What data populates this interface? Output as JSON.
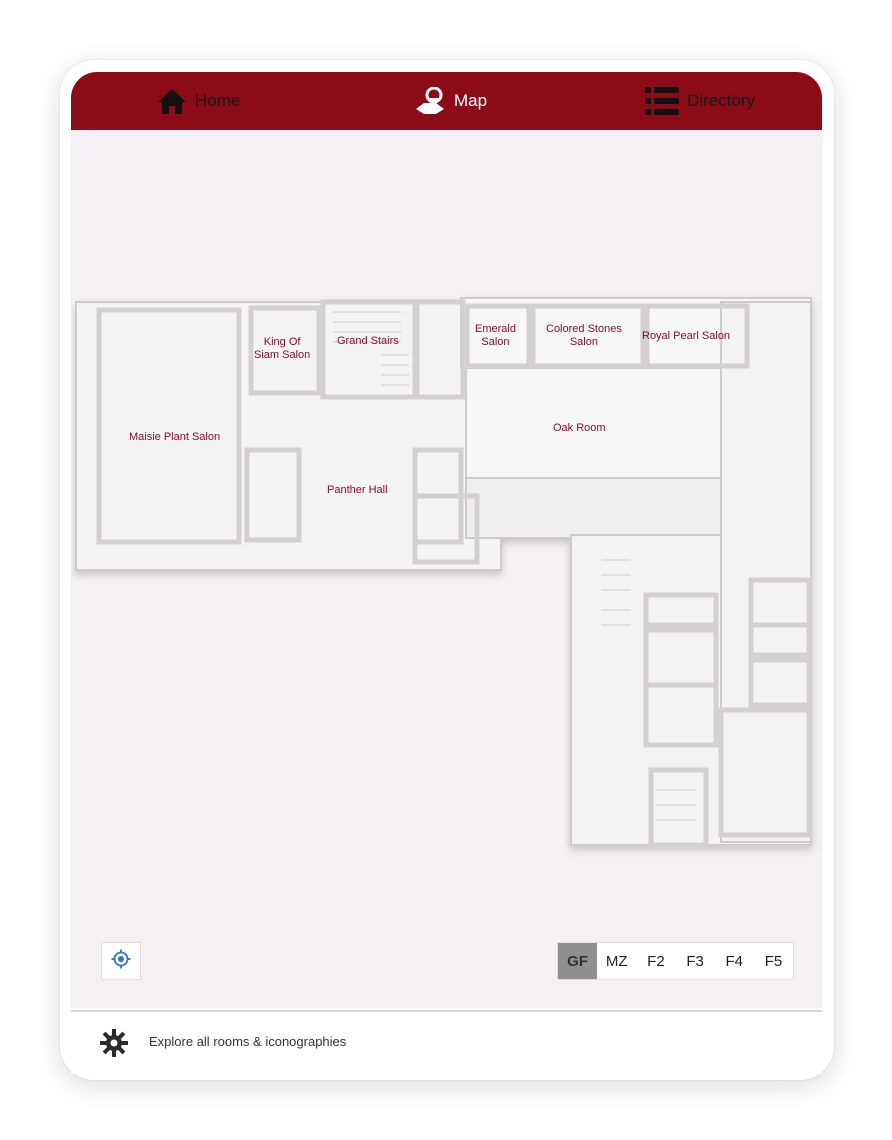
{
  "nav": {
    "home_label": "Home",
    "map_label": "Map",
    "directory_label": "Directory",
    "home_icon": "home-icon",
    "map_icon": "map-pin-icon",
    "directory_icon": "list-icon",
    "bar_color": "#8b0c16"
  },
  "map": {
    "rooms": {
      "maisie": "Maisie Plant Salon",
      "king_line1": "King Of",
      "king_line2": "Siam Salon",
      "grand_stairs": "Grand Stairs",
      "emerald_line1": "Emerald",
      "emerald_line2": "Salon",
      "colored_line1": "Colored Stones",
      "colored_line2": "Salon",
      "royal": "Royal Pearl Salon",
      "oak": "Oak Room",
      "panther": "Panther Hall"
    },
    "label_color": "#8b0c2a",
    "locate_icon": "locate-icon"
  },
  "floors": {
    "items": [
      "GF",
      "MZ",
      "F2",
      "F3",
      "F4",
      "F5"
    ],
    "active": "GF"
  },
  "footer": {
    "icon": "gear-icon",
    "text": "Explore all rooms & iconographies"
  }
}
